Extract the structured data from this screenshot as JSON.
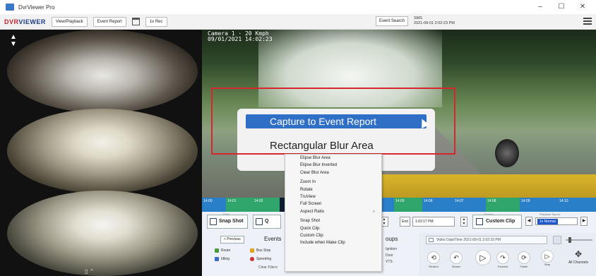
{
  "window": {
    "title": "DvrViewer Pro",
    "controls": [
      "–",
      "☐",
      "✕"
    ]
  },
  "toolbar": {
    "logo_part1": "DVR",
    "logo_part2": "VIEWER",
    "view_playback": "View/Playback",
    "event_report": "Event Report",
    "extra_btn": "1v Rec",
    "event_search": "Event Search",
    "sms_label": "SMS",
    "sms_datetime": "2021-09-01 2:02:23 PM"
  },
  "video": {
    "osd_line1": "Camera 1 · 20 Kmph",
    "osd_line2": "09/01/2021 14:02:23",
    "zoom_capture": "Capture to Event Report",
    "zoom_blur": "Rectangular Blur Area"
  },
  "context_menu": {
    "items": [
      "Elipse Blur Area",
      "Elipse Blur Inverted",
      "Clear Blur Area",
      "",
      "Zoom In",
      "Rotate",
      "TruView",
      "Full Screen",
      "Aspect Ratio",
      "",
      "Snap Shot",
      "Quick Clip",
      "Custom Clip",
      "Include when Make Clip"
    ],
    "submenu_arrow": "›"
  },
  "timeline": {
    "segments": [
      "14:00",
      "14:01",
      "14:02",
      "",
      "14:03",
      "14:04",
      "14:05",
      "14:06",
      "14:07",
      "14:08",
      "14:09",
      "14:10"
    ]
  },
  "controls": {
    "snap_caption": "Snap",
    "snap_shot": "Snap Shot",
    "quick_clip": "Q",
    "previous": "< Previous",
    "events_label": "Events",
    "events": [
      "Route",
      "Bus Stop",
      "Idling",
      "Speeding"
    ],
    "clear_filters": "Clear Filters",
    "groups_label": "oups",
    "groups": [
      "Ignition",
      "Door",
      "VTS"
    ],
    "end_label": "End",
    "end_value": "1:02:17 PM",
    "custom_caption": "Export",
    "custom_clip": "Custom Clip",
    "speed_caption": "Playback Speed",
    "speed_value": "1x Normal",
    "video_datetime": "Video Date/Time 2021-09-01 2:02:23 PM",
    "playback_buttons": [
      "Rewind",
      "Slower",
      "Play",
      "Forward",
      "Faster",
      "Stop"
    ],
    "all_channels": "All Channels"
  },
  "left_panel": {
    "footer_icons": "▯   ⌃"
  }
}
